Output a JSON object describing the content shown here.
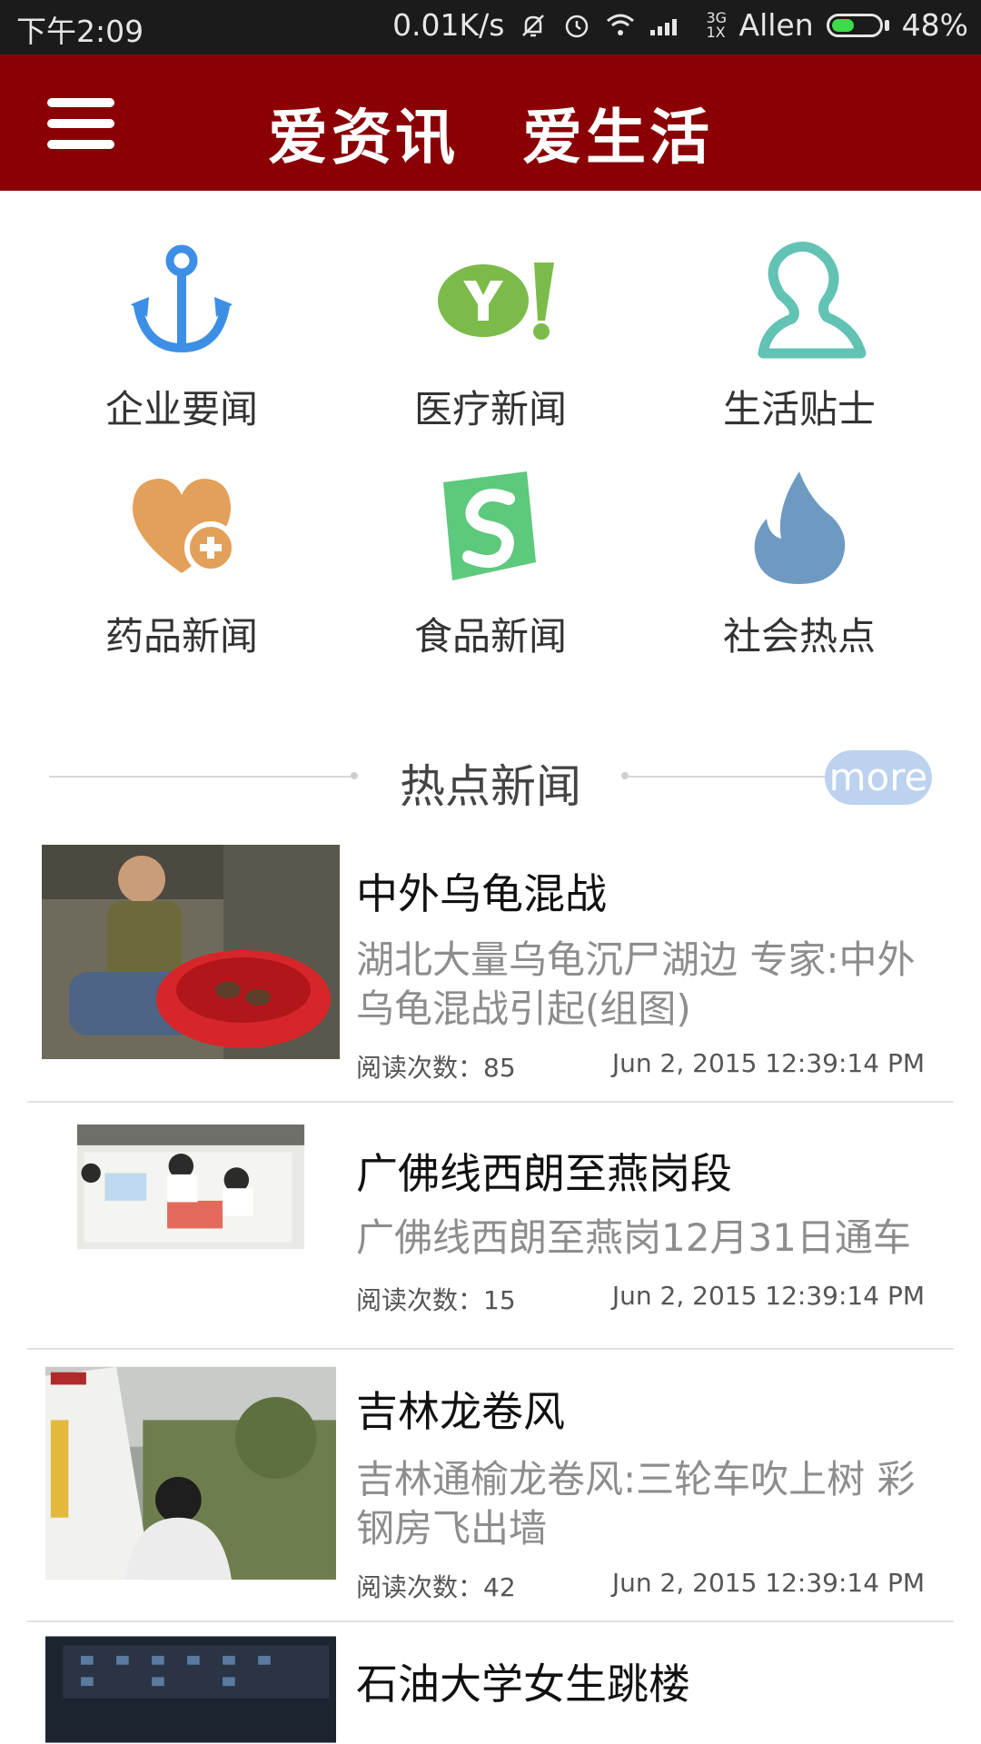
{
  "status_bar": {
    "time": "下午2:09",
    "speed": "0.01K/s",
    "network_type": "3G 1X",
    "carrier": "Allen",
    "battery": "48%",
    "battery_level": 0.48,
    "icons": [
      "mute-icon",
      "alarm-icon",
      "wifi-icon",
      "signal-icon",
      "battery-icon"
    ]
  },
  "app_bar": {
    "title": "爱资讯　爱生活",
    "menu_icon": "hamburger-menu-icon",
    "background": "#8a0005"
  },
  "categories": [
    {
      "label": "企业要闻",
      "icon": "anchor-icon",
      "color": "#3d8fe6"
    },
    {
      "label": "医疗新闻",
      "icon": "yahoo-logo-icon",
      "color": "#7cbb4a"
    },
    {
      "label": "生活贴士",
      "icon": "person-outline-icon",
      "color": "#62c2b4"
    },
    {
      "label": "药品新闻",
      "icon": "heart-plus-icon",
      "color": "#e2a05a"
    },
    {
      "label": "食品新闻",
      "icon": "s-logo-icon",
      "color": "#5cc97c"
    },
    {
      "label": "社会热点",
      "icon": "flame-icon",
      "color": "#6e9ac2"
    }
  ],
  "hot_news": {
    "title": "热点新闻",
    "more_label": "more"
  },
  "news": [
    {
      "headline": "中外乌龟混战",
      "summary": "湖北大量乌龟沉尸湖边 专家:中外乌龟混战引起(组图)",
      "reads": "阅读次数：85",
      "date": "Jun 2, 2015 12:39:14 PM"
    },
    {
      "headline": "广佛线西朗至燕岗段",
      "summary": "广佛线西朗至燕岗12月31日通车",
      "reads": "阅读次数：15",
      "date": "Jun 2, 2015 12:39:14 PM"
    },
    {
      "headline": "吉林龙卷风",
      "summary": "吉林通榆龙卷风:三轮车吹上树 彩钢房飞出墙",
      "reads": "阅读次数：42",
      "date": "Jun 2, 2015 12:39:14 PM"
    },
    {
      "headline": "石油大学女生跳楼"
    }
  ]
}
